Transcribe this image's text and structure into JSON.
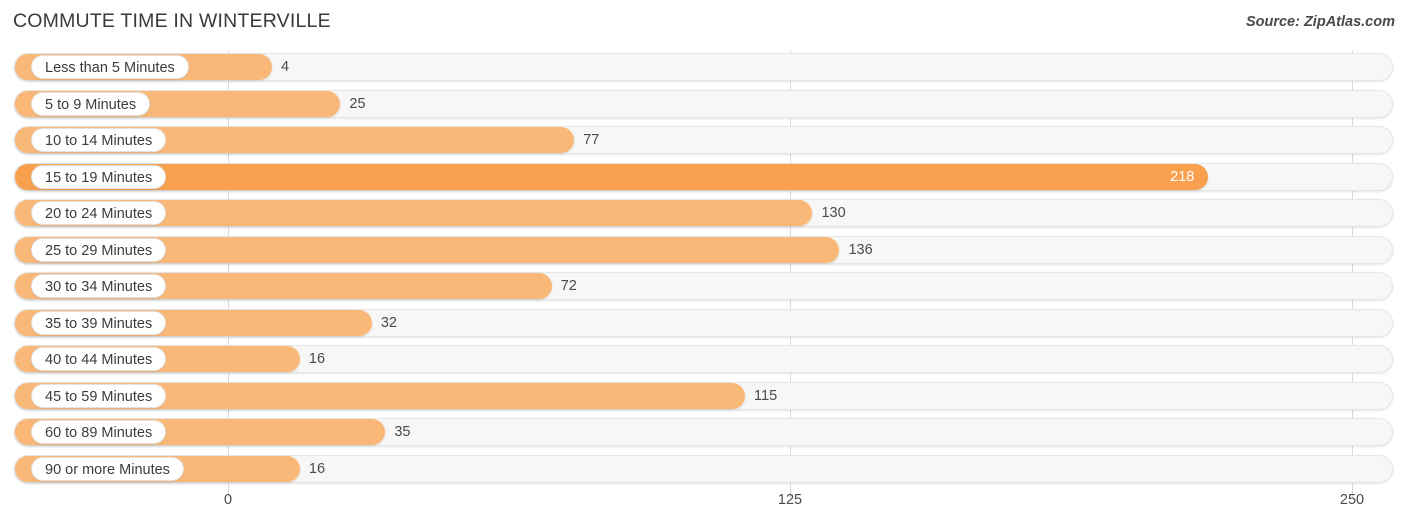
{
  "header": {
    "title": "COMMUTE TIME IN WINTERVILLE",
    "source": "Source: ZipAtlas.com"
  },
  "colors": {
    "bar": "#fab878",
    "bar_highlight": "#f9a04f",
    "track": "#f7f7f7",
    "gridline": "#d8d8d8",
    "text": "#3c3c3c"
  },
  "axis": {
    "ticks": [
      "0",
      "125",
      "250"
    ],
    "tick_values": [
      0,
      125,
      250
    ]
  },
  "chart_data": {
    "type": "bar",
    "orientation": "horizontal",
    "title": "COMMUTE TIME IN WINTERVILLE",
    "subtitle": "",
    "xlabel": "",
    "ylabel": "",
    "xlim": [
      0,
      250
    ],
    "grid": true,
    "legend": "none",
    "source": "Source: ZipAtlas.com",
    "categories": [
      "Less than 5 Minutes",
      "5 to 9 Minutes",
      "10 to 14 Minutes",
      "15 to 19 Minutes",
      "20 to 24 Minutes",
      "25 to 29 Minutes",
      "30 to 34 Minutes",
      "35 to 39 Minutes",
      "40 to 44 Minutes",
      "45 to 59 Minutes",
      "60 to 89 Minutes",
      "90 or more Minutes"
    ],
    "values": [
      4,
      25,
      77,
      218,
      130,
      136,
      72,
      32,
      16,
      115,
      35,
      16
    ],
    "highlight_index": 3
  },
  "rows": [
    {
      "label": "Less than 5 Minutes",
      "value": 4,
      "value_text": "4",
      "highlight": false
    },
    {
      "label": "5 to 9 Minutes",
      "value": 25,
      "value_text": "25",
      "highlight": false
    },
    {
      "label": "10 to 14 Minutes",
      "value": 77,
      "value_text": "77",
      "highlight": false
    },
    {
      "label": "15 to 19 Minutes",
      "value": 218,
      "value_text": "218",
      "highlight": true
    },
    {
      "label": "20 to 24 Minutes",
      "value": 130,
      "value_text": "130",
      "highlight": false
    },
    {
      "label": "25 to 29 Minutes",
      "value": 136,
      "value_text": "136",
      "highlight": false
    },
    {
      "label": "30 to 34 Minutes",
      "value": 72,
      "value_text": "72",
      "highlight": false
    },
    {
      "label": "35 to 39 Minutes",
      "value": 32,
      "value_text": "32",
      "highlight": false
    },
    {
      "label": "40 to 44 Minutes",
      "value": 16,
      "value_text": "16",
      "highlight": false
    },
    {
      "label": "45 to 59 Minutes",
      "value": 115,
      "value_text": "115",
      "highlight": false
    },
    {
      "label": "60 to 89 Minutes",
      "value": 35,
      "value_text": "35",
      "highlight": false
    },
    {
      "label": "90 or more Minutes",
      "value": 16,
      "value_text": "16",
      "highlight": false
    }
  ]
}
